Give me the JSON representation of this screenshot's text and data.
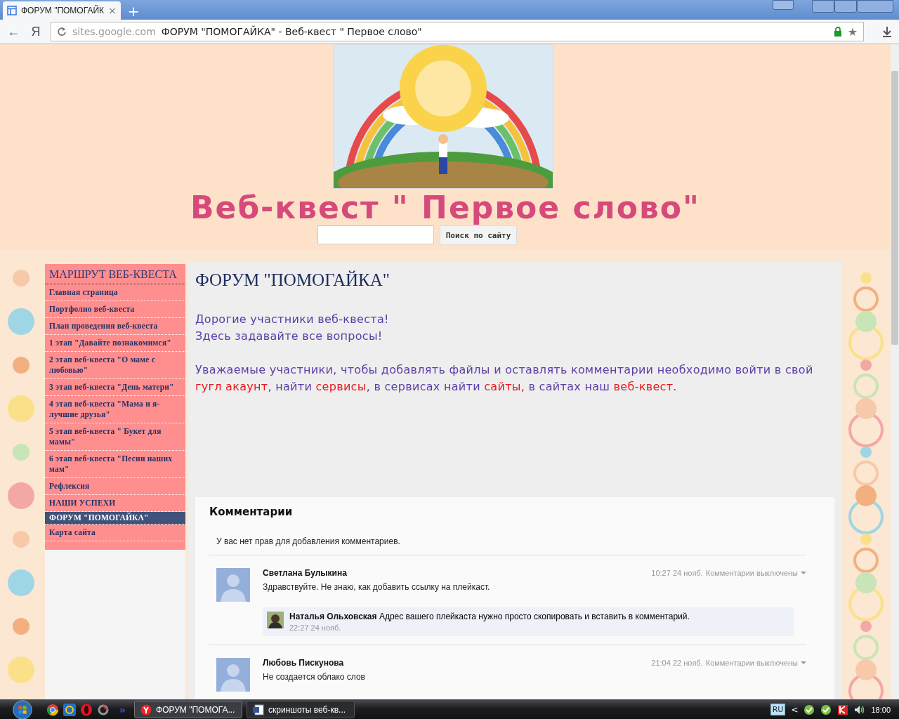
{
  "browser": {
    "tab_title": "ФОРУМ \"ПОМОГАЙК",
    "tab_close": "×",
    "new_tab": "+",
    "back": "←",
    "yandex": "Я",
    "url_host": "sites.google.com",
    "url_title": "ФОРУМ \"ПОМОГАЙКА\" - Веб-квест \" Первое слово\"",
    "secure": true,
    "star": "★"
  },
  "header": {
    "site_title": "Веб-квест \" Первое слово\"",
    "search_button": "Поиск по сайту"
  },
  "sidebar": {
    "title": "МАРШРУТ ВЕБ-КВЕСТА",
    "items": [
      {
        "label": "Главная страница",
        "selected": false
      },
      {
        "label": "Портфолио веб-квеста",
        "selected": false
      },
      {
        "label": "План проведения веб-квеста",
        "selected": false
      },
      {
        "label": "1 этап \"Давайте познакомимся\"",
        "selected": false
      },
      {
        "label": "2 этап веб-квеста \"О маме с любовью\"",
        "selected": false
      },
      {
        "label": "3 этап веб-квеста \"День матери\"",
        "selected": false
      },
      {
        "label": "4 этап веб-квеста \"Мама и я-лучшие друзья\"",
        "selected": false
      },
      {
        "label": "5 этап веб-квеста \" Букет для мамы\"",
        "selected": false
      },
      {
        "label": "6 этап веб-квеста \"Песни наших мам\"",
        "selected": false
      },
      {
        "label": "Рефлексия",
        "selected": false
      },
      {
        "label": "НАШИ УСПЕХИ",
        "selected": false
      },
      {
        "label": "ФОРУМ \"ПОМОГАЙКА\"",
        "selected": true
      },
      {
        "label": "Карта сайта",
        "selected": false
      }
    ]
  },
  "content": {
    "heading": "ФОРУМ \"ПОМОГАЙКА\"",
    "paragraphs": [
      [
        {
          "text": "Дорогие участники веб-квеста!",
          "kind": "normal"
        }
      ],
      [
        {
          "text": "Здесь задавайте все вопросы!",
          "kind": "normal"
        }
      ],
      [
        {
          "text": "Уважаемые участники, чтобы добавлять файлы и оставлять комментарии необходимо войти в свой ",
          "kind": "normal"
        },
        {
          "text": "гугл акаунт",
          "kind": "highlight"
        },
        {
          "text": ", найти ",
          "kind": "normal"
        },
        {
          "text": "сервисы",
          "kind": "highlight"
        },
        {
          "text": ", в сервисах найти ",
          "kind": "normal"
        },
        {
          "text": "сайты,",
          "kind": "highlight"
        },
        {
          "text": " в сайтах наш ",
          "kind": "normal"
        },
        {
          "text": "веб-квест.",
          "kind": "highlight"
        }
      ]
    ]
  },
  "comments": {
    "title": "Комментарии",
    "notice": "У вас нет прав для добавления комментариев.",
    "items": [
      {
        "author": "Светлана Булыкина",
        "text": "Здравствуйте. Не знаю, как добавить ссылку на плейкаст.",
        "time": "10:27 24 нояб.",
        "status": "Комментарии выключены",
        "replies": [
          {
            "author": "Наталья Ольховская",
            "text": "Адрес вашего плейкаста нужно просто скопировать и вставить в комментарий.",
            "time": "22:27 24 нояб."
          }
        ]
      },
      {
        "author": "Любовь Пискунова",
        "text": "Не создается облако слов",
        "time": "21:04 22 нояб.",
        "status": "Комментарии выключены"
      }
    ]
  },
  "taskbar": {
    "chevron": "»",
    "tasks": [
      {
        "label": "ФОРУМ \"ПОМОГА...",
        "kind": "browser",
        "selected": true
      },
      {
        "label": "скриншоты веб-кв...",
        "kind": "document",
        "selected": false
      }
    ],
    "language": "RU",
    "tray_arrow": "<",
    "clock": "18:00"
  }
}
